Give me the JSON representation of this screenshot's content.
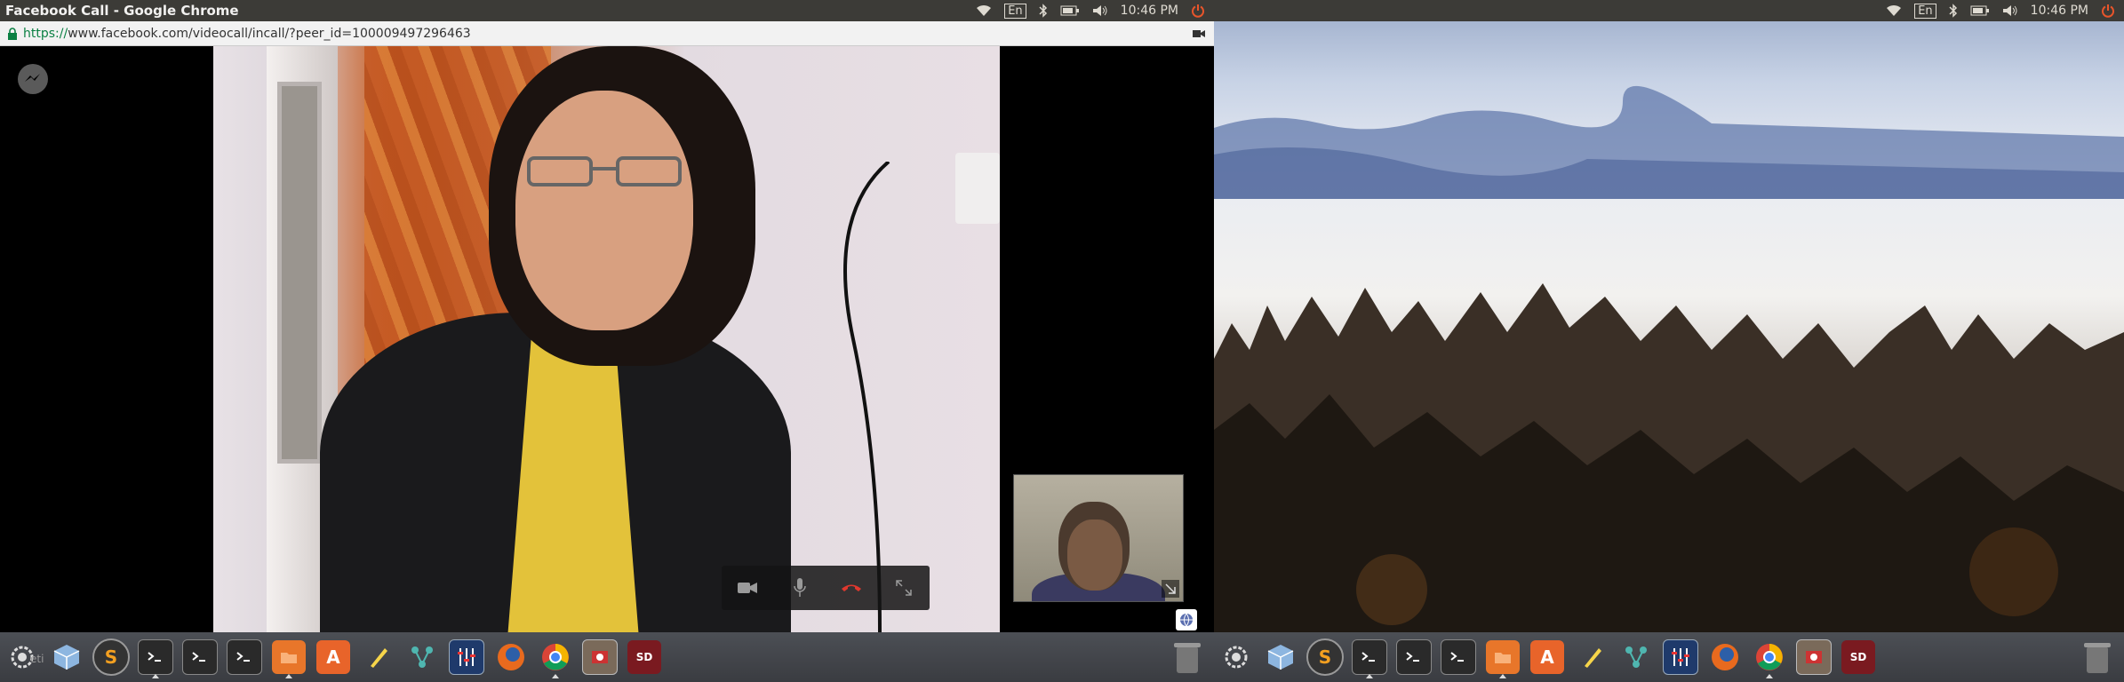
{
  "top_panel_left": {
    "window_title": "Facebook Call - Google Chrome",
    "lang": "En",
    "clock": "10:46 PM"
  },
  "top_panel_right": {
    "lang": "En",
    "clock": "10:46 PM"
  },
  "urlbar": {
    "scheme": "https://",
    "rest": "www.facebook.com/videocall/incall/?peer_id=100009497296463"
  },
  "call": {
    "controls": [
      "video-camera-icon",
      "microphone-icon",
      "end-call-icon",
      "fullscreen-icon"
    ]
  },
  "dock_left_items": [
    {
      "name": "system-settings",
      "icon": "settings-gear-icon"
    },
    {
      "name": "virtualbox",
      "icon": "cube-icon"
    },
    {
      "name": "sublime-text",
      "icon": "sublime-icon"
    },
    {
      "name": "terminal-1",
      "icon": "terminal-icon"
    },
    {
      "name": "terminal-2",
      "icon": "terminal-icon"
    },
    {
      "name": "terminal-3",
      "icon": "terminal-icon"
    },
    {
      "name": "files",
      "icon": "folder-icon"
    },
    {
      "name": "software-center",
      "icon": "software-center-icon"
    },
    {
      "name": "text-editor",
      "icon": "pencil-icon"
    },
    {
      "name": "network-tool",
      "icon": "network-icon"
    },
    {
      "name": "mixer",
      "icon": "equalizer-icon"
    },
    {
      "name": "firefox",
      "icon": "firefox-icon"
    },
    {
      "name": "chrome",
      "icon": "chrome-icon"
    },
    {
      "name": "image-viewer",
      "icon": "image-viewer-icon"
    },
    {
      "name": "sd-card",
      "icon": "sd-card-icon"
    }
  ],
  "dock_badge": "SD",
  "sublime_letter": "S",
  "software_letter": "A",
  "ghost_label": "eti"
}
